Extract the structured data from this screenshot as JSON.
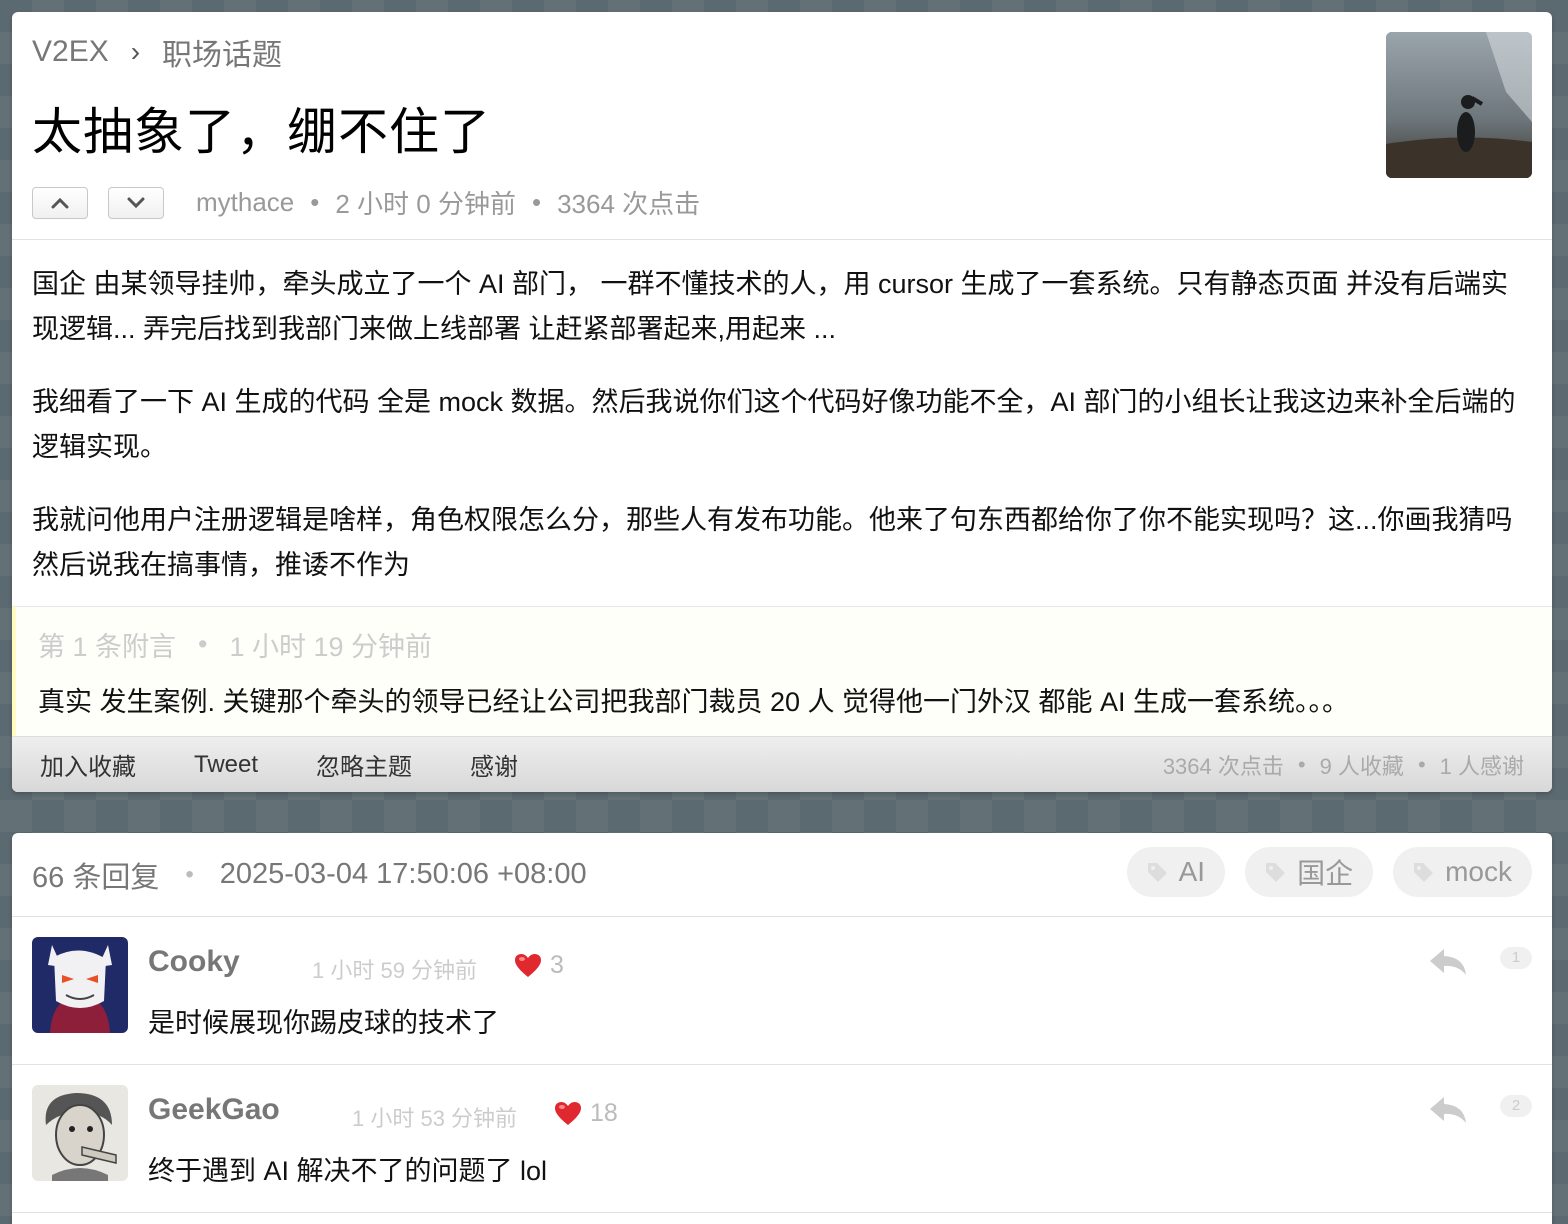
{
  "breadcrumb": {
    "site": "V2EX",
    "separator": "›",
    "node": "职场话题"
  },
  "topic": {
    "title": "太抽象了，绷不住了",
    "author": "mythace",
    "time": "2 小时 0 分钟前",
    "clicks": "3364 次点击",
    "paragraphs": [
      "国企 由某领导挂帅，牵头成立了一个 AI 部门， 一群不懂技术的人，用 cursor 生成了一套系统。只有静态页面 并没有后端实现逻辑... 弄完后找到我部门来做上线部署 让赶紧部署起来,用起来 ...",
      "我细看了一下 AI 生成的代码 全是 mock 数据。然后我说你们这个代码好像功能不全，AI 部门的小组长让我这边来补全后端的逻辑实现。",
      "我就问他用户注册逻辑是啥样，角色权限怎么分，那些人有发布功能。他来了句东西都给你了你不能实现吗？这...你画我猜吗 然后说我在搞事情，推诿不作为"
    ],
    "appendix": {
      "label": "第 1 条附言",
      "time": "1 小时 19 分钟前",
      "text": "真实 发生案例. 关键那个牵头的领导已经让公司把我部门裁员 20 人 觉得他一门外汉 都能 AI 生成一套系统。。。"
    }
  },
  "toolbar": {
    "favorite": "加入收藏",
    "tweet": "Tweet",
    "ignore": "忽略主题",
    "thank": "感谢",
    "stat_clicks": "3364 次点击",
    "stat_favs": "9 人收藏",
    "stat_thanks": "1 人感谢"
  },
  "replies_header": {
    "count": "66 条回复",
    "dot": "•",
    "datetime": "2025-03-04 17:50:06 +08:00",
    "tags": [
      "AI",
      "国企",
      "mock"
    ]
  },
  "replies": [
    {
      "user": "Cooky",
      "time": "1 小时 59 分钟前",
      "likes": "3",
      "text": "是时候展现你踢皮球的技术了",
      "no": "1"
    },
    {
      "user": "GeekGao",
      "time": "1 小时 53 分钟前",
      "likes": "18",
      "text": "终于遇到 AI 解决不了的问题了 lol",
      "no": "2"
    }
  ],
  "meta_dot": "•",
  "icons": [
    "chevron-up-icon",
    "chevron-down-icon",
    "tag-icon",
    "heart-icon",
    "reply-icon"
  ],
  "colors": {
    "appendix_bg": "#fffff9",
    "appendix_border": "#fffbc1",
    "heart": "#e0282f",
    "page_bg": "#5b6970"
  }
}
